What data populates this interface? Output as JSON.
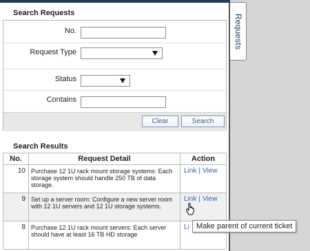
{
  "side_tab": {
    "label": "Requests"
  },
  "search": {
    "title": "Search Requests",
    "no_label": "No.",
    "no_value": "",
    "request_type_label": "Request Type",
    "request_type_value": "",
    "status_label": "Status",
    "status_value": "",
    "contains_label": "Contains",
    "contains_value": "",
    "clear_label": "Clear",
    "search_label": "Search"
  },
  "results": {
    "title": "Search Results",
    "columns": [
      "No.",
      "Request Detail",
      "Action"
    ],
    "rows": [
      {
        "no": "10",
        "detail": "Purchase 12 1U rack mount storage systems: Each storage system should handle 250 TB of data storage.",
        "link": "Link",
        "view": "View"
      },
      {
        "no": "9",
        "detail": "Set up a server room: Configure a new server room with 12 1U servers and 12 1U storage systems.",
        "link": "Link",
        "view": "View"
      },
      {
        "no": "8",
        "detail": "Purchase 12 1U rack mount servers: Each server should have at least 16 TB HD storage",
        "link": "Li",
        "view": ""
      }
    ]
  },
  "tooltip": {
    "text": "Make parent of current ticket"
  },
  "colors": {
    "header_bar": "#1f3d5a",
    "link": "#3461a6",
    "gutter": "#d6d6d6"
  }
}
